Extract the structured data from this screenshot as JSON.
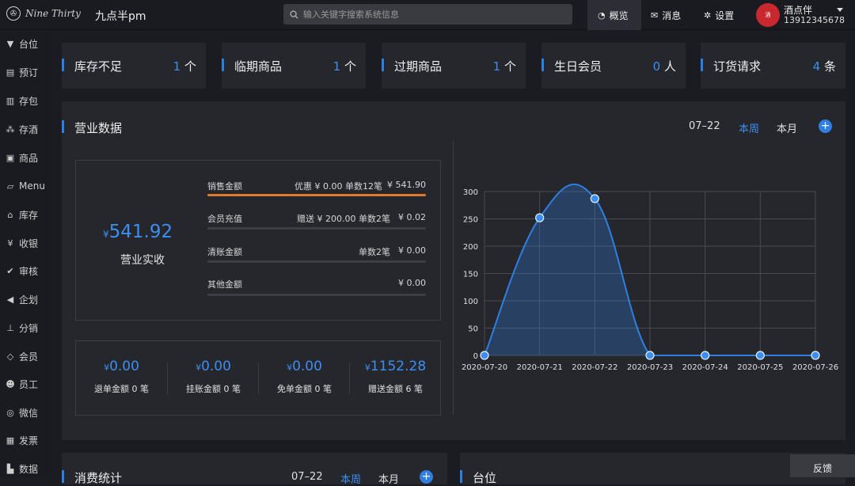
{
  "app": {
    "logo_text": "Nine Thirty",
    "store_name": "九点半pm"
  },
  "search": {
    "placeholder": "输入关键字搜索系统信息"
  },
  "top_nav": [
    {
      "label": "概览",
      "icon": "dashboard-icon"
    },
    {
      "label": "消息",
      "icon": "envelope-icon"
    },
    {
      "label": "设置",
      "icon": "gear-icon"
    }
  ],
  "user": {
    "name": "酒点伴",
    "phone": "13912345678"
  },
  "sidebar": [
    {
      "label": "台位",
      "icon": "funnel-icon"
    },
    {
      "label": "预订",
      "icon": "document-icon"
    },
    {
      "label": "存包",
      "icon": "briefcase-icon"
    },
    {
      "label": "存酒",
      "icon": "cubes-icon"
    },
    {
      "label": "商品",
      "icon": "bag-icon"
    },
    {
      "label": "Menu",
      "icon": "book-icon"
    },
    {
      "label": "库存",
      "icon": "home-icon"
    },
    {
      "label": "收银",
      "icon": "yen-icon"
    },
    {
      "label": "审核",
      "icon": "check-circle-icon"
    },
    {
      "label": "企划",
      "icon": "megaphone-icon"
    },
    {
      "label": "分销",
      "icon": "sitemap-icon"
    },
    {
      "label": "会员",
      "icon": "diamond-icon"
    },
    {
      "label": "员工",
      "icon": "users-icon"
    },
    {
      "label": "微信",
      "icon": "wechat-icon"
    },
    {
      "label": "发票",
      "icon": "invoice-icon"
    },
    {
      "label": "数据",
      "icon": "chart-icon"
    }
  ],
  "stats": [
    {
      "label": "库存不足",
      "value": "1",
      "unit": "个"
    },
    {
      "label": "临期商品",
      "value": "1",
      "unit": "个"
    },
    {
      "label": "过期商品",
      "value": "1",
      "unit": "个"
    },
    {
      "label": "生日会员",
      "value": "0",
      "unit": "人"
    },
    {
      "label": "订货请求",
      "value": "4",
      "unit": "条"
    }
  ],
  "business": {
    "title": "营业数据",
    "date": "07–22",
    "tab_week": "本周",
    "tab_month": "本月",
    "total_currency": "¥",
    "total_amount": "541.92",
    "total_label": "营业实收",
    "rows": [
      {
        "label": "销售金额",
        "detail": "优惠 ¥ 0.00      单数12笔",
        "amount": "¥ 541.90",
        "fill": 1.0
      },
      {
        "label": "会员充值",
        "detail": "赠送 ¥ 200.00      单数2笔",
        "amount": "¥ 0.02",
        "fill": 0
      },
      {
        "label": "清账金额",
        "detail": "单数2笔",
        "amount": "¥ 0.00",
        "fill": 0
      },
      {
        "label": "其他金额",
        "detail": "",
        "amount": "¥ 0.00",
        "fill": 0
      }
    ],
    "minis": [
      {
        "currency": "¥",
        "amount": "0.00",
        "label": "退单金额 0 笔"
      },
      {
        "currency": "¥",
        "amount": "0.00",
        "label": "挂账金额 0 笔"
      },
      {
        "currency": "¥",
        "amount": "0.00",
        "label": "免单金额 0 笔"
      },
      {
        "currency": "¥",
        "amount": "1152.28",
        "label": "赠送金额 6 笔"
      }
    ]
  },
  "chart_data": {
    "type": "area",
    "x": [
      "2020-07-20",
      "2020-07-21",
      "2020-07-22",
      "2020-07-23",
      "2020-07-24",
      "2020-07-25",
      "2020-07-26"
    ],
    "values": [
      0,
      252,
      287,
      0,
      0,
      0,
      0
    ],
    "ylim": [
      0,
      300
    ],
    "yticks": [
      0,
      50,
      100,
      150,
      200,
      250,
      300
    ],
    "grid": true,
    "color": "#2f7fe0"
  },
  "bottom": {
    "left_title": "消费统计",
    "left_date": "07–22",
    "left_tab_week": "本周",
    "left_tab_month": "本月",
    "right_title": "台位"
  },
  "feedback": "反馈"
}
